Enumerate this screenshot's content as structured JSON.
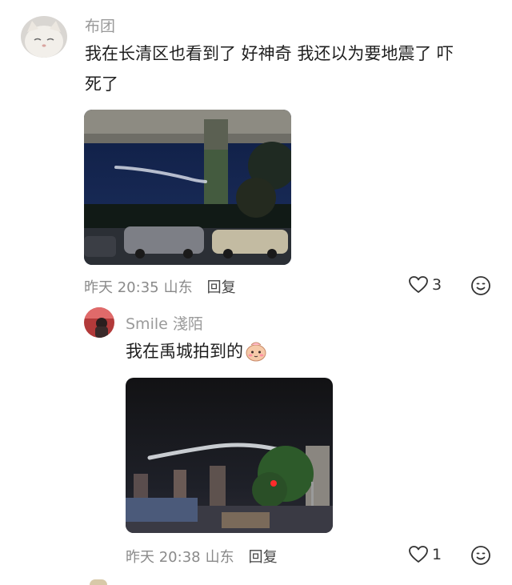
{
  "comments": [
    {
      "username": "布团",
      "text_line1": "我在长清区也看到了  好神奇  我还以为要地震了  吓",
      "text_line2": "死了",
      "time": "昨天 20:35",
      "location": "山东",
      "reply_label": "回复",
      "likes": "3"
    },
    {
      "username": "Smile 淺陌",
      "text": "我在禹城拍到的",
      "sticker": "shy-face-emoji",
      "time": "昨天 20:38",
      "location": "山东",
      "reply_label": "回复",
      "likes": "1"
    }
  ],
  "icons": {
    "like": "heart-outline-icon",
    "emoji": "smiley-face-icon"
  },
  "colors": {
    "meta_gray": "#8a8a8a",
    "username_gray": "#9a9a9a",
    "text": "#1f1f1f"
  }
}
